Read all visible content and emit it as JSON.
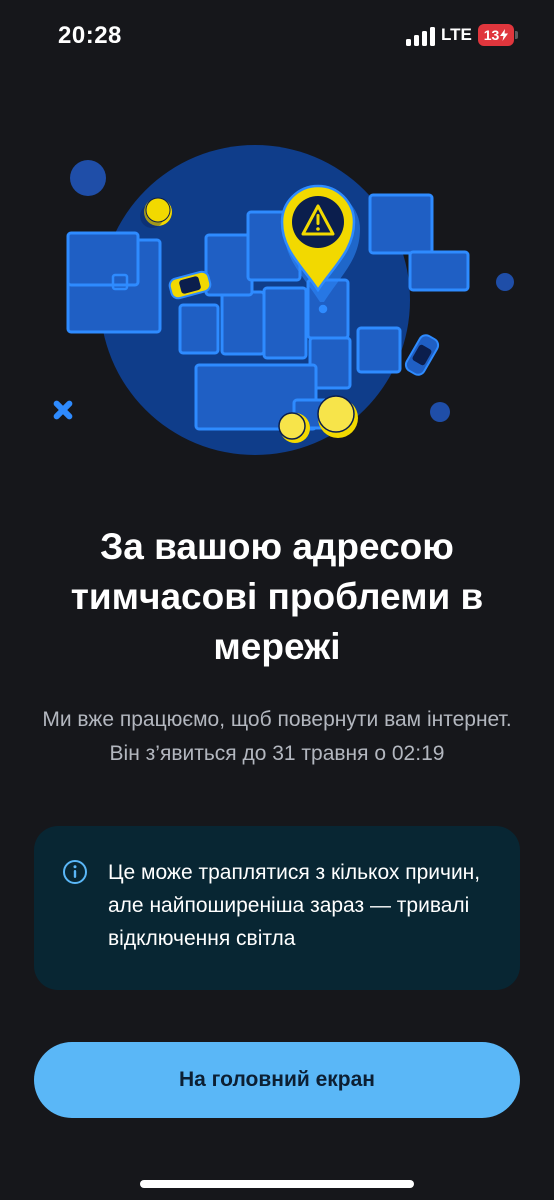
{
  "status_bar": {
    "time": "20:28",
    "network": "LTE",
    "battery": "13"
  },
  "illustration": {
    "alt_icons": [
      "warning-pin-icon",
      "car-icon",
      "coin-icon"
    ],
    "colors": {
      "dark_blue": "#0f3d8a",
      "blue": "#1f5fc4",
      "outline": "#2e8bff",
      "yellow": "#f2d900",
      "navy": "#0b1e4d"
    }
  },
  "headline": "За вашою адресою тимчасові проблеми в мережі",
  "subtext": "Ми вже працюємо, щоб повернути вам інтернет. Він з’явиться до 31 травня о 02:19",
  "info_card": {
    "icon": "info-icon",
    "text": "Це може траплятися з кількох причин, але найпоширеніша зараз — тривалі відключення світла"
  },
  "button": {
    "label": "На головний екран"
  },
  "colors": {
    "background": "#16171b",
    "accent": "#5ab7f7",
    "card": "#082633",
    "battery": "#e0363d"
  }
}
